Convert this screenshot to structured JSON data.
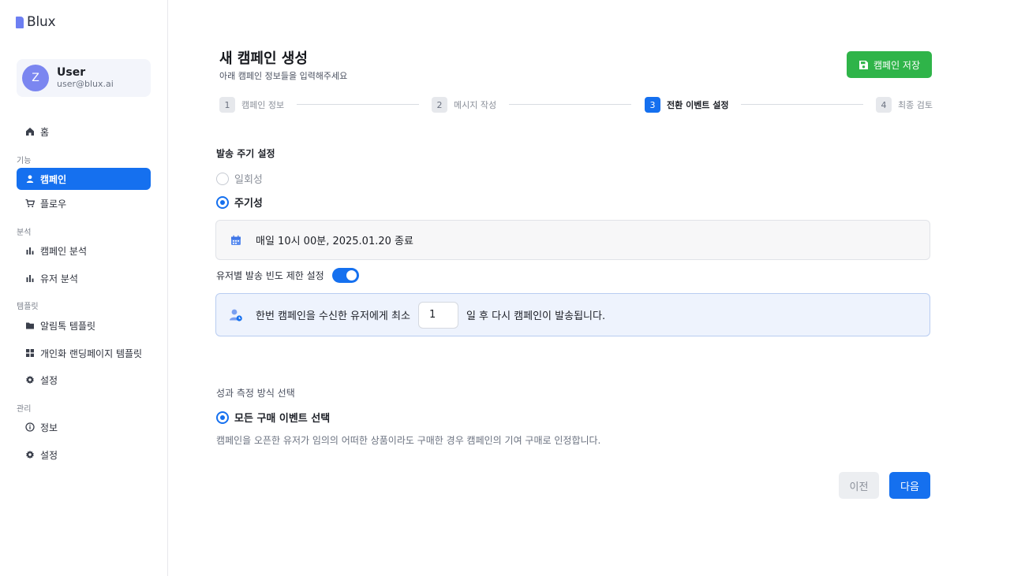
{
  "app": {
    "logo_text": "Blux"
  },
  "user": {
    "initial": "Z",
    "name": "User",
    "email": "user@blux.ai"
  },
  "sidebar": {
    "home": {
      "label": "홈",
      "icon": "home-icon"
    },
    "sections": {
      "features": "기능",
      "analytics": "분석",
      "templates": "템플릿",
      "admin": "관리"
    },
    "items": {
      "campaign": {
        "label": "캠페인",
        "icon": "user-icon",
        "active": true
      },
      "flow": {
        "label": "플로우",
        "icon": "cart-icon"
      },
      "campaign_analytics": {
        "label": "캠페인 분석",
        "icon": "bar-chart-icon"
      },
      "user_analytics": {
        "label": "유저 분석",
        "icon": "bar-chart-icon"
      },
      "alimtalk_template": {
        "label": "알림톡 템플릿",
        "icon": "folder-icon"
      },
      "landing_template": {
        "label": "개인화 랜딩페이지 템플릿",
        "icon": "grid-icon"
      },
      "template_settings": {
        "label": "설정",
        "icon": "gear-icon"
      },
      "info": {
        "label": "정보",
        "icon": "info-icon"
      },
      "admin_settings": {
        "label": "설정",
        "icon": "gear-icon"
      }
    }
  },
  "header": {
    "title": "새 캠페인 생성",
    "subtitle": "아래 캠페인 정보들을 입력해주세요",
    "save_label": "캠페인 저장"
  },
  "stepper": {
    "steps": [
      {
        "num": "1",
        "label": "캠페인 정보"
      },
      {
        "num": "2",
        "label": "메시지 작성"
      },
      {
        "num": "3",
        "label": "전환 이벤트 설정",
        "active": true
      },
      {
        "num": "4",
        "label": "최종 검토"
      }
    ]
  },
  "schedule": {
    "title": "발송 주기 설정",
    "options": [
      {
        "label": "일회성",
        "selected": false
      },
      {
        "label": "주기성",
        "selected": true
      }
    ],
    "summary": "매일 10시 00분, 2025.01.20 종료"
  },
  "frequency": {
    "toggle_label": "유저별 발송 빈도 제한 설정",
    "enabled": true,
    "text_before": "한번 캠페인을 수신한 유저에게 최소",
    "value": "1",
    "text_after": "일 후 다시 캠페인이 발송됩니다."
  },
  "measurement": {
    "title": "성과 측정 방식 선택",
    "option_label": "모든 구매 이벤트 선택",
    "description": "캠페인을 오픈한 유저가 임의의 어떠한 상품이라도 구매한 경우 캠페인의 기여 구매로 인정합니다."
  },
  "footer": {
    "prev_label": "이전",
    "next_label": "다음"
  },
  "colors": {
    "primary": "#1570ef",
    "save_green": "#2fb449",
    "avatar": "#7b86f0"
  }
}
